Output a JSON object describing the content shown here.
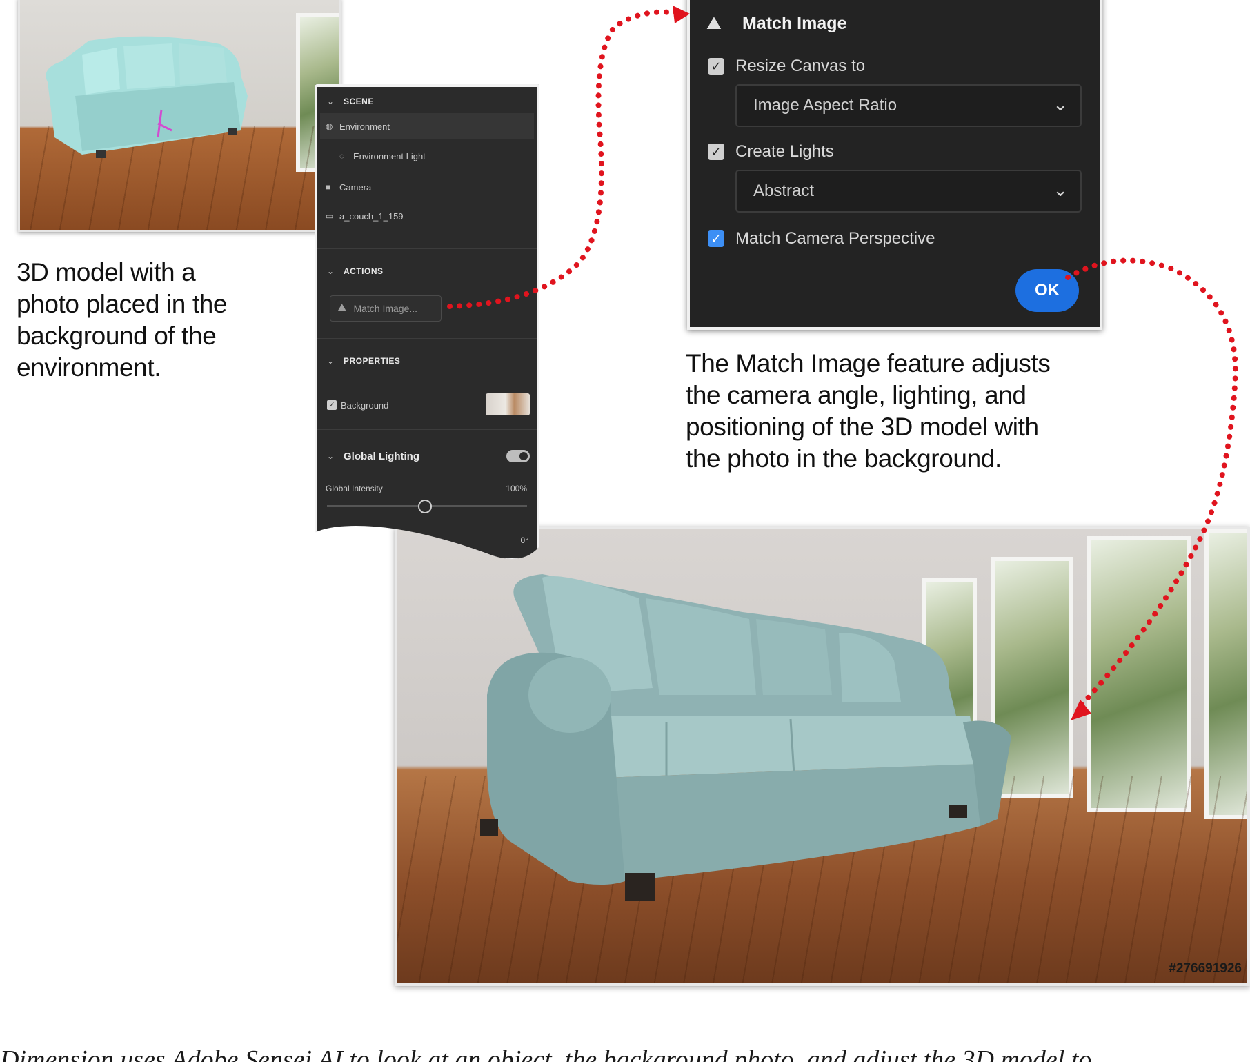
{
  "captions": {
    "left": [
      "3D model with a",
      "photo placed in the",
      "background of the",
      "environment."
    ],
    "right": [
      "The Match Image feature adjusts",
      "the camera angle, lighting, and",
      "positioning of the 3D model with",
      "the photo in the background."
    ]
  },
  "scene_panel": {
    "sections": {
      "scene": "SCENE",
      "actions": "ACTIONS",
      "properties": "PROPERTIES",
      "global_lighting": "Global Lighting"
    },
    "items": {
      "environment": "Environment",
      "environment_light": "Environment Light",
      "camera": "Camera",
      "couch": "a_couch_1_159"
    },
    "match_image_button": "Match Image...",
    "background_label": "Background",
    "global_intensity_label": "Global Intensity",
    "global_intensity_value": "100%",
    "angle_value": "0°"
  },
  "dialog": {
    "title": "Match Image",
    "resize_canvas_label": "Resize Canvas to",
    "resize_canvas_value": "Image Aspect Ratio",
    "create_lights_label": "Create Lights",
    "create_lights_value": "Abstract",
    "match_camera_label": "Match Camera Perspective",
    "ok_label": "OK"
  },
  "watermark": "#276691926",
  "bottom_text": "Dimension uses Adobe Sensei AI to look at an object, the background photo, and adjust the 3D model to",
  "colors": {
    "arrow": "#e0141e",
    "ok_button": "#1d6fe0",
    "checkbox_checked": "#3d8ff5",
    "panel_bg": "#2b2b2b",
    "dialog_bg": "#232323"
  }
}
